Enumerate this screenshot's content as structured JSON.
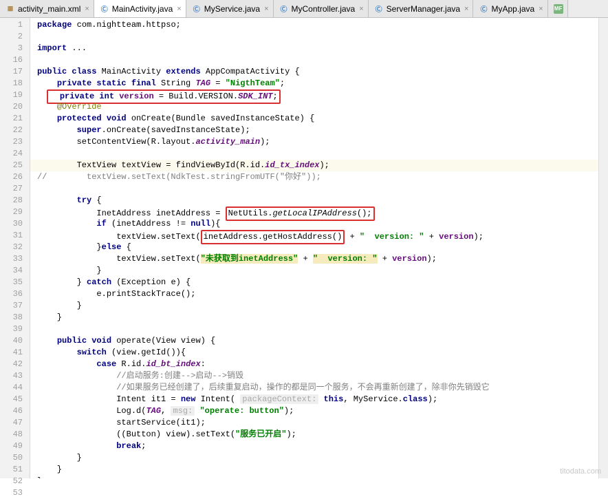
{
  "tabs": [
    {
      "label": "activity_main.xml",
      "icon": "xml"
    },
    {
      "label": "MainActivity.java",
      "icon": "java",
      "active": true
    },
    {
      "label": "MyService.java",
      "icon": "java"
    },
    {
      "label": "MyController.java",
      "icon": "java"
    },
    {
      "label": "ServerManager.java",
      "icon": "java"
    },
    {
      "label": "MyApp.java",
      "icon": "java"
    },
    {
      "label": "",
      "icon": "mf"
    }
  ],
  "gutter_lines": [
    "1",
    "2",
    "3",
    "16",
    "17",
    "18",
    "19",
    "20",
    "21",
    "22",
    "23",
    "24",
    "25",
    "26",
    "27",
    "28",
    "29",
    "30",
    "31",
    "32",
    "33",
    "34",
    "35",
    "36",
    "37",
    "38",
    "39",
    "40",
    "41",
    "42",
    "43",
    "44",
    "45",
    "46",
    "47",
    "48",
    "49",
    "50",
    "51",
    "52",
    "53"
  ],
  "code": {
    "l1_kw": "package",
    "l1_rest": " com.nightteam.httpso;",
    "l3_kw": "import",
    "l3_rest": " ...",
    "l17_a": "public class",
    "l17_b": " MainActivity ",
    "l17_c": "extends",
    "l17_d": " AppCompatActivity {",
    "l18_a": "private static final",
    "l18_b": " String ",
    "l18_c": "TAG",
    "l18_d": " = ",
    "l18_e": "\"NigthTeam\"",
    "l18_f": ";",
    "l19_a": "private int",
    "l19_b": " ",
    "l19_c": "version",
    "l19_d": " = Build.VERSION.",
    "l19_e": "SDK_INT",
    "l19_f": ";",
    "l20": "@Override",
    "l21_a": "protected void",
    "l21_b": " onCreate(Bundle savedInstanceState) {",
    "l22_a": "super",
    "l22_b": ".onCreate(savedInstanceState);",
    "l23_a": "setContentView(R.layout.",
    "l23_b": "activity_main",
    "l23_c": ");",
    "l25_a": "TextView textView = findViewById(R.id.",
    "l25_b": "id_tx_index",
    "l25_c": ");",
    "l26": "//        textView.setText(NdkTest.stringFromUTF(\"你好\"));",
    "l28_a": "try",
    "l28_b": " {",
    "l29_a": "InetAddress inetAddress = ",
    "l29_box": "NetUtils.getLocalIPAddress();",
    "l30_a": "if",
    "l30_b": " (inetAddress != ",
    "l30_c": "null",
    "l30_d": "){",
    "l31_a": "textView.setText(",
    "l31_box": "inetAddress.getHostAddress()",
    "l31_b": " + ",
    "l31_c": "\"  version: \"",
    "l31_d": " + ",
    "l31_e": "version",
    "l31_f": ");",
    "l32_a": "}",
    "l32_b": "else",
    "l32_c": " {",
    "l33_a": "textView.setText(",
    "l33_b": "\"未获取到inetAddress\"",
    "l33_c": " + ",
    "l33_d": "\"  version: \"",
    "l33_e": " + ",
    "l33_f": "version",
    "l33_g": ");",
    "l34": "}",
    "l35_a": "} ",
    "l35_b": "catch",
    "l35_c": " (Exception e) {",
    "l36": "e.printStackTrace();",
    "l37": "}",
    "l38": "}",
    "l40_a": "public void",
    "l40_b": " operate(View view) {",
    "l41_a": "switch",
    "l41_b": " (view.getId()){",
    "l42_a": "case",
    "l42_b": " R.id.",
    "l42_c": "id_bt_index",
    "l42_d": ":",
    "l43": "//启动服务:创建-->启动-->销毁",
    "l44": "//如果服务已经创建了，后续重复启动，操作的都是同一个服务，不会再重新创建了，除非你先销毁它",
    "l45_a": "Intent it1 = ",
    "l45_b": "new",
    "l45_c": " Intent( ",
    "l45_hint": "packageContext:",
    "l45_d": " ",
    "l45_e": "this",
    "l45_f": ", MyService.",
    "l45_g": "class",
    "l45_h": ");",
    "l46_a": "Log.d(",
    "l46_b": "TAG",
    "l46_c": ", ",
    "l46_hint": "msg:",
    "l46_d": " ",
    "l46_e": "\"operate: button\"",
    "l46_f": ");",
    "l47": "startService(it1);",
    "l48_a": "((Button) view).setText(",
    "l48_b": "\"服务已开启\"",
    "l48_c": ");",
    "l49_a": "break",
    "l49_b": ";",
    "l50": "}",
    "l51": "}",
    "l52": "}"
  },
  "watermark": "titodata.com"
}
